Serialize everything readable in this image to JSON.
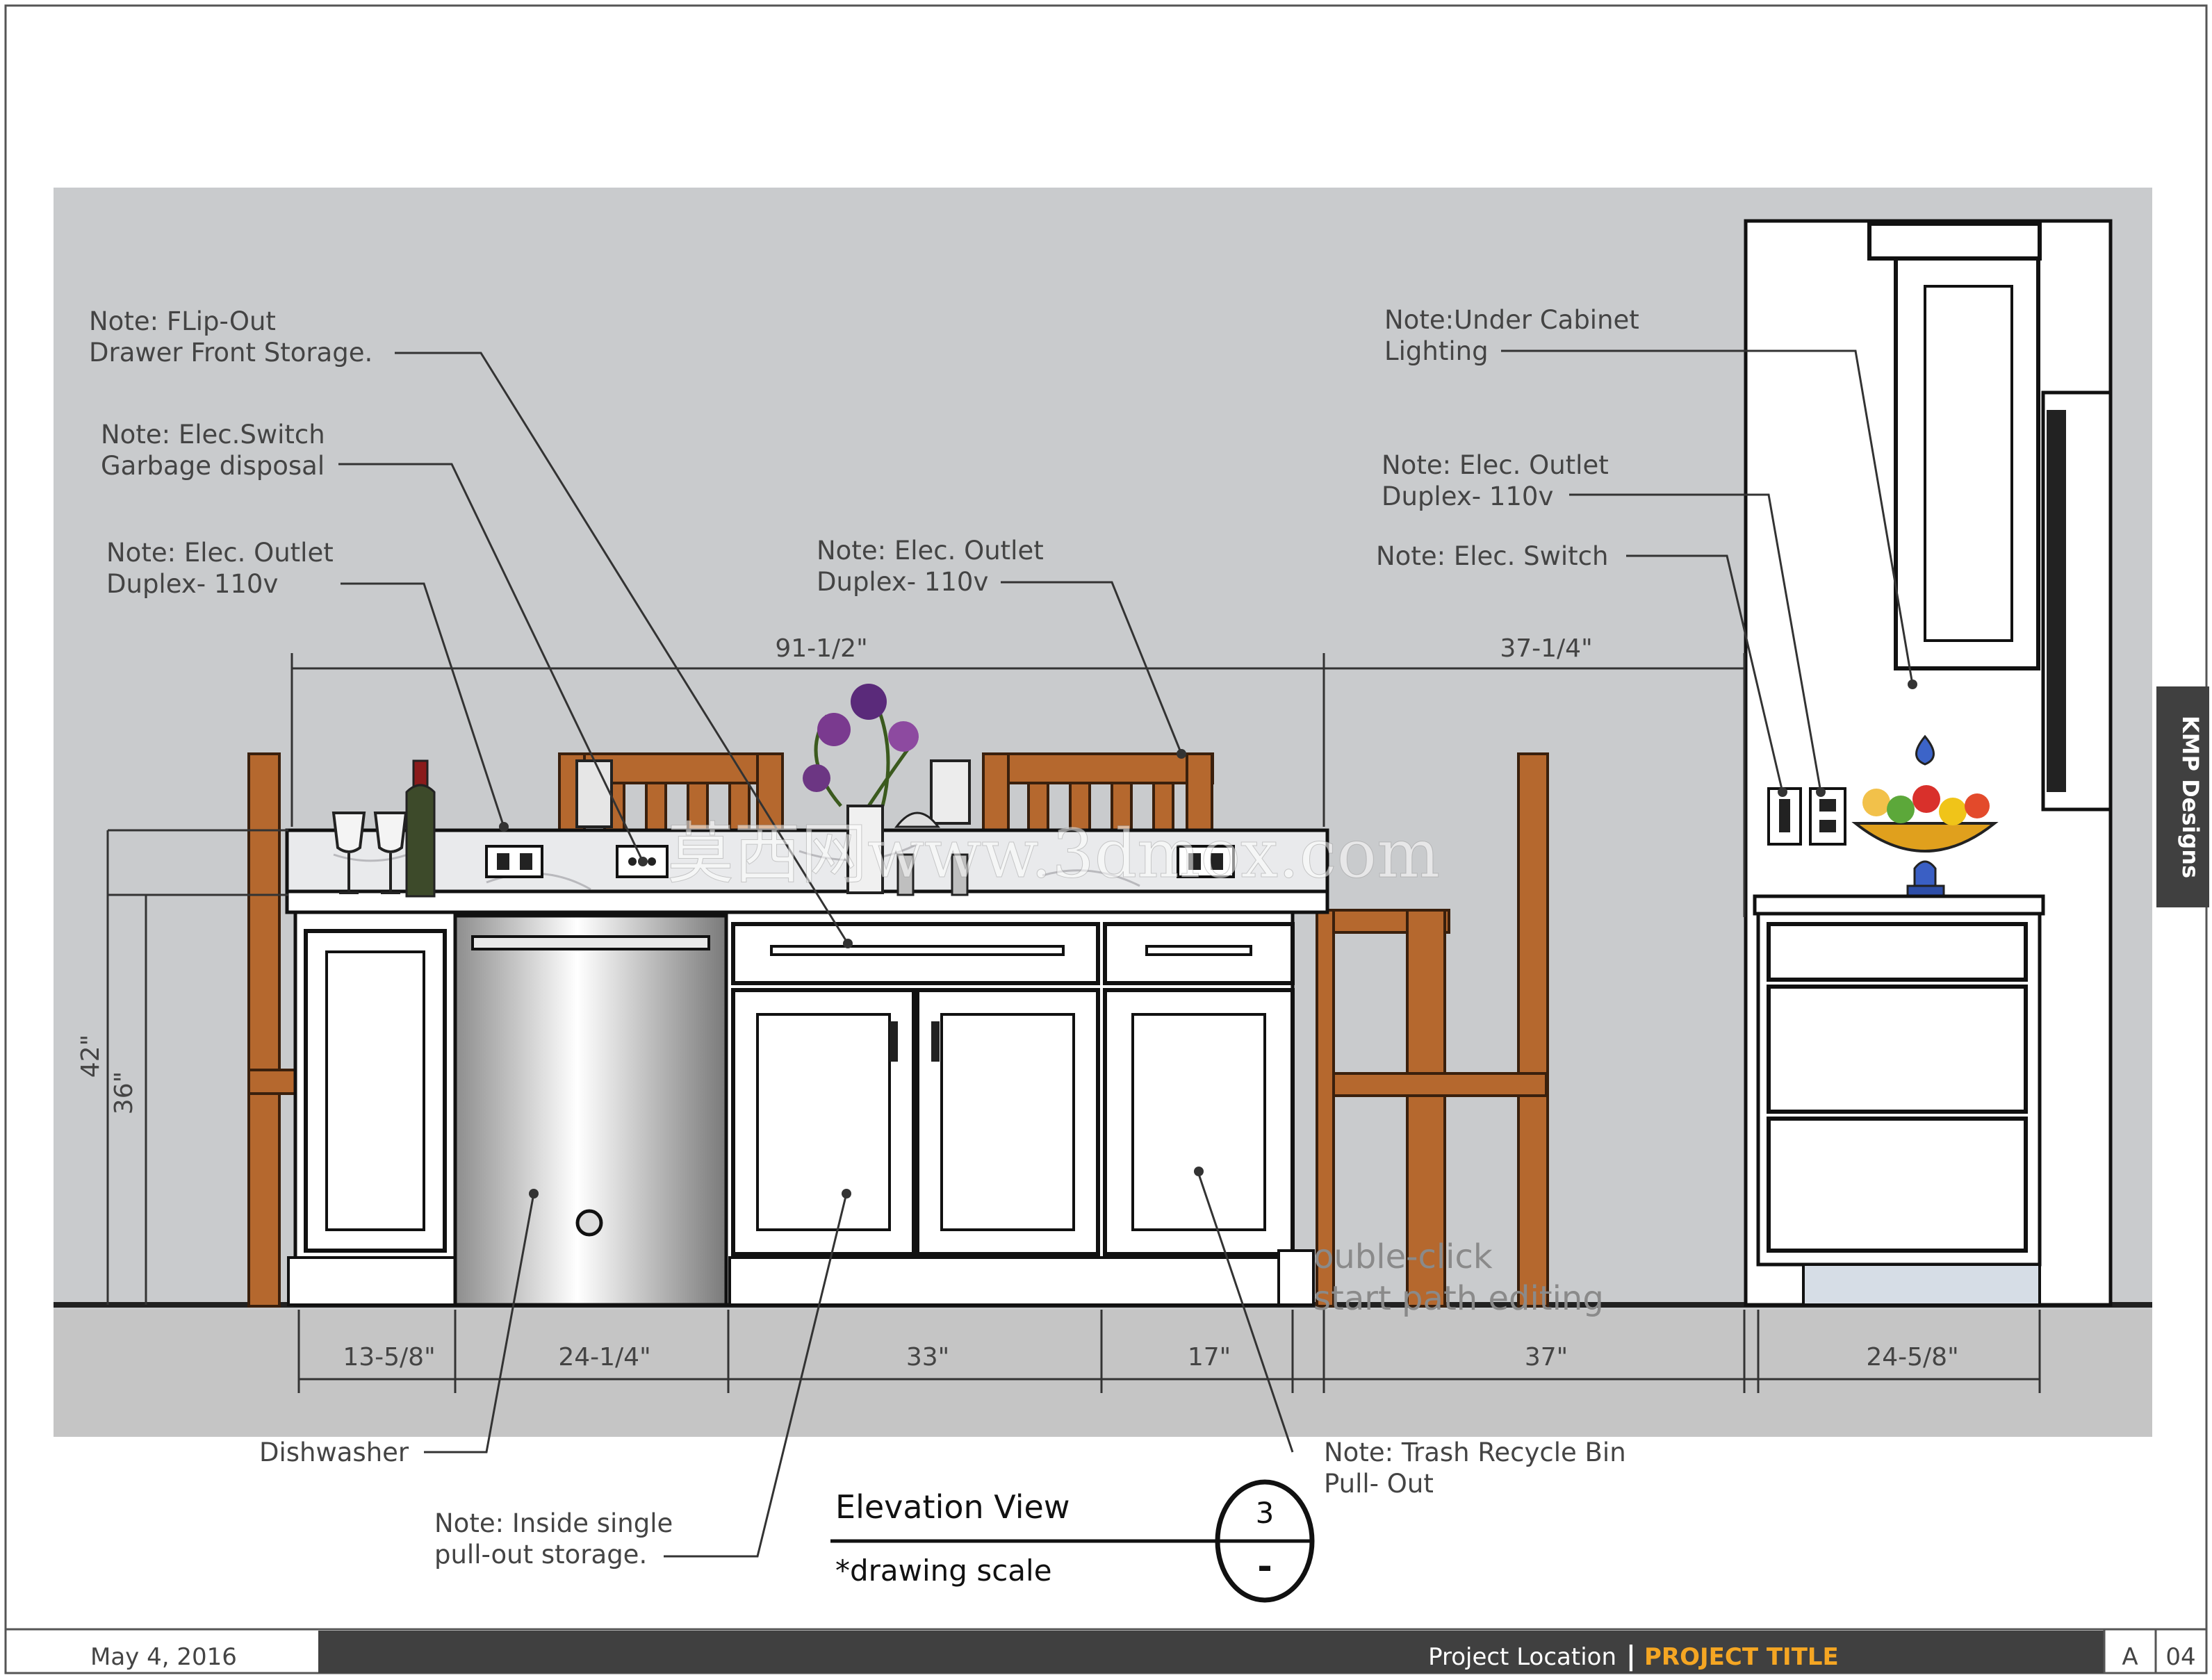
{
  "notes": {
    "flip_out": [
      "Note: FLip-Out",
      "Drawer Front Storage."
    ],
    "elec_switch_disposal": [
      "Note: Elec.Switch",
      "Garbage disposal"
    ],
    "elec_outlet_left": [
      "Note: Elec. Outlet",
      "Duplex- 110v"
    ],
    "elec_outlet_center": [
      "Note: Elec. Outlet",
      "Duplex- 110v"
    ],
    "under_cabinet": [
      "Note:Under Cabinet",
      "Lighting"
    ],
    "elec_outlet_right": [
      "Note: Elec. Outlet",
      "Duplex- 110v"
    ],
    "elec_switch_right": "Note: Elec. Switch",
    "dishwasher": "Dishwasher",
    "inside_storage": [
      "Note: Inside single",
      "pull-out storage."
    ],
    "trash_bin": [
      "Note: Trash Recycle Bin",
      "Pull- Out"
    ]
  },
  "dimensions": {
    "top": [
      "91-1/2\"",
      "37-1/4\""
    ],
    "vertical": [
      "42\"",
      "36\""
    ],
    "bottom": [
      "13-5/8\"",
      "24-1/4\"",
      "33\"",
      "17\"",
      "37\"",
      "24-5/8\""
    ]
  },
  "overlay_text": {
    "hint_line1": "ouble-click",
    "hint_line2": "start path editing",
    "watermark": "莫西网www.3dmox.com"
  },
  "title_block": {
    "view_title": "Elevation View",
    "scale": "*drawing scale",
    "detail_number": "3",
    "detail_sheet": "-"
  },
  "side_tab": "KMP Designs",
  "footer": {
    "date": "May 4, 2016",
    "project_location": "Project Location",
    "separator": "|",
    "project_title": "PROJECT TITLE",
    "sheet_letter": "A",
    "sheet_number": "04"
  },
  "colors": {
    "wall": "#c9cbcd",
    "floor": "#c5c5c5",
    "footer_bar": "#404040",
    "accent": "#f5a623",
    "wood": "#b5682e"
  }
}
